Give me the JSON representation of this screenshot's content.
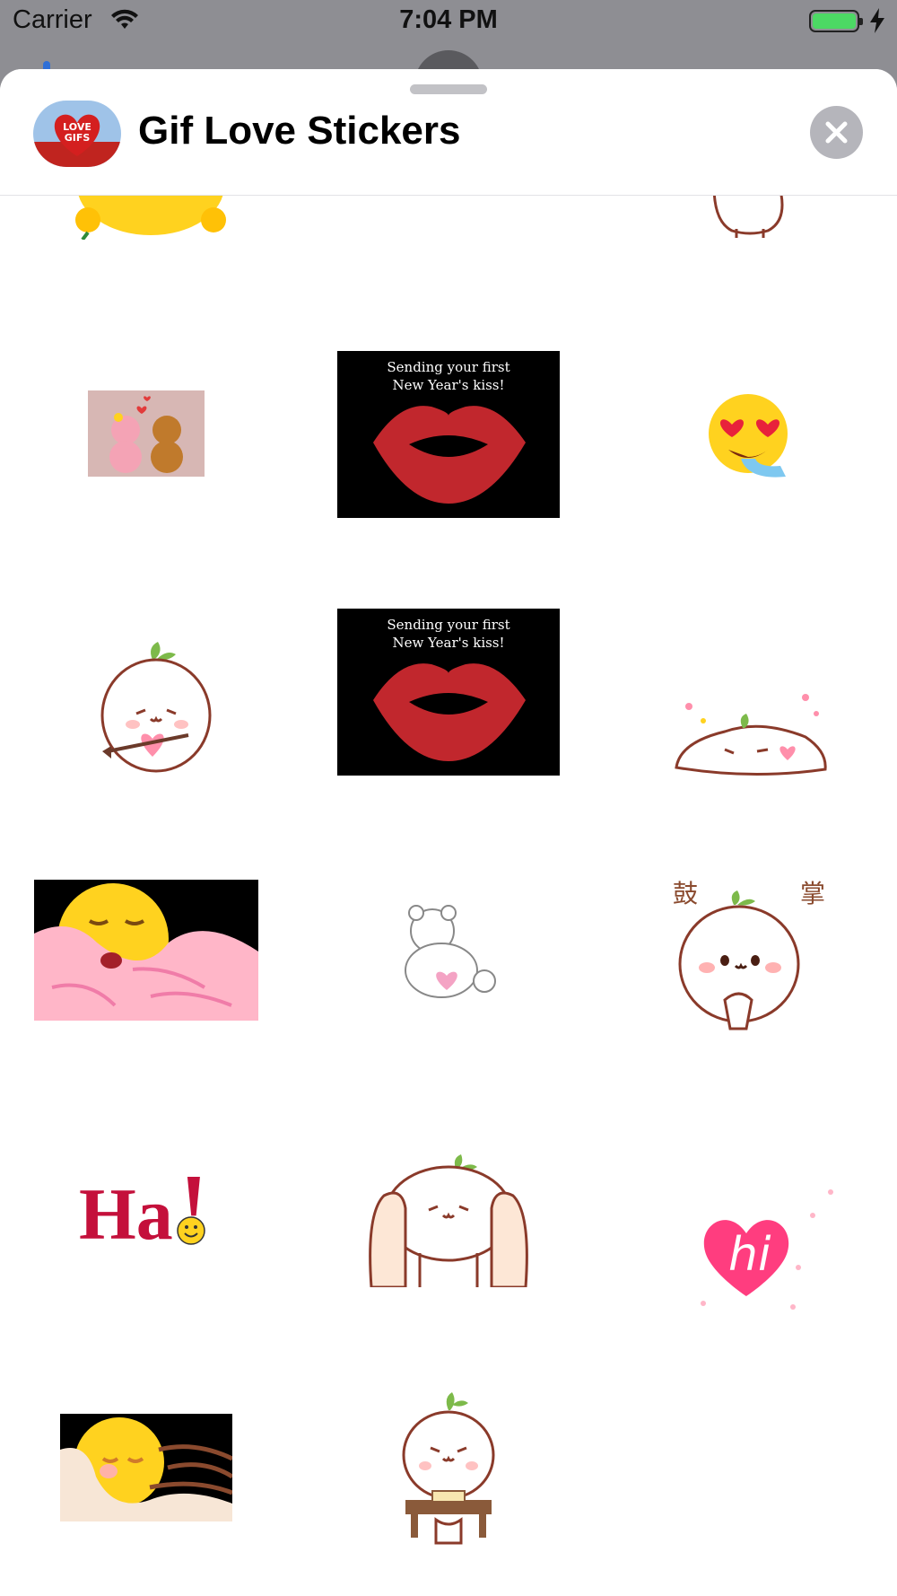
{
  "status_bar": {
    "carrier": "Carrier",
    "time": "7:04 PM",
    "battery_color": "#4cd964"
  },
  "header": {
    "app_title": "Gif Love Stickers",
    "app_icon_text_line1": "LOVE",
    "app_icon_text_line2": "GIFS",
    "close_icon": "close-x-icon"
  },
  "stickers": {
    "kiss_card_1": {
      "line1": "Sending your first",
      "line2": "New Year's kiss!"
    },
    "kiss_card_2": {
      "line1": "Sending your first",
      "line2": "New Year's kiss!"
    },
    "clap_text_left": "鼓",
    "clap_text_right": "掌",
    "ha_text": "Ha",
    "ha_exclaim": "!",
    "hi_text": "hi"
  },
  "colors": {
    "sheet_background": "#ffffff",
    "dimmed_background": "#8e8e93",
    "kiss_lips": "#c1272d",
    "heart_pink": "#ff3d7f",
    "emoji_yellow": "#ffd21f"
  }
}
